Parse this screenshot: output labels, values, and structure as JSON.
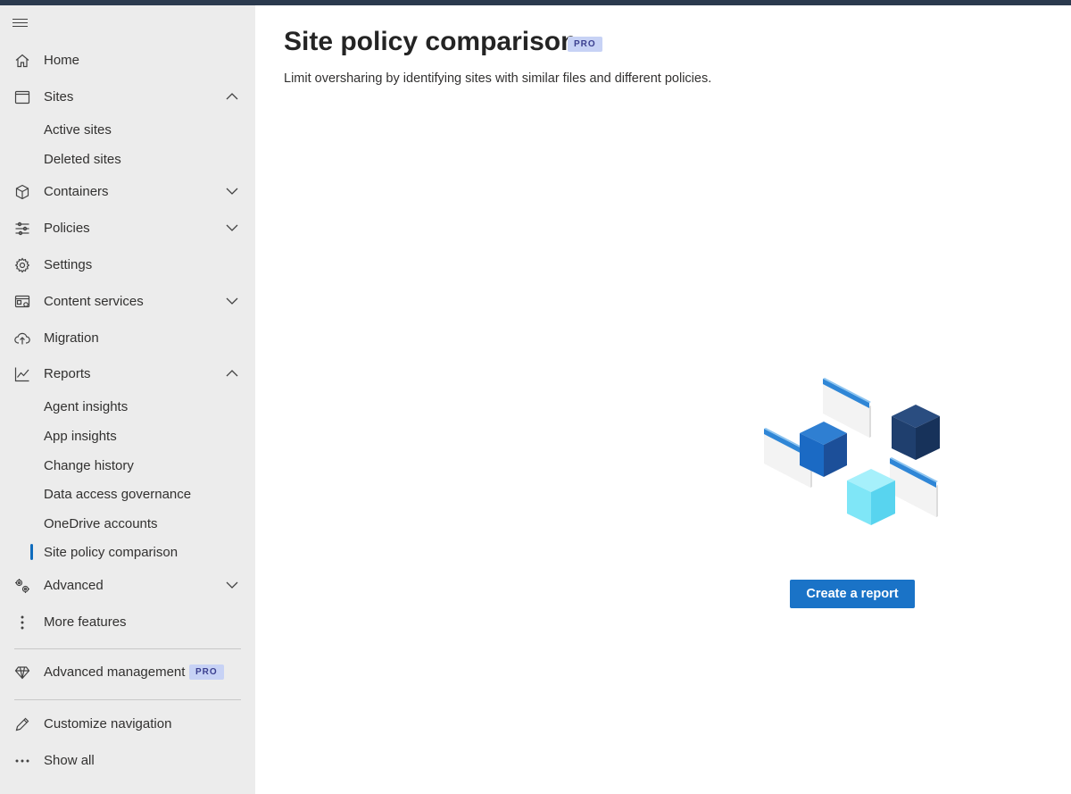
{
  "nav": {
    "items": [
      {
        "id": "home",
        "label": "Home",
        "icon": "home-icon"
      },
      {
        "id": "sites",
        "label": "Sites",
        "icon": "browser-window-icon",
        "expanded": true,
        "children": [
          {
            "label": "Active sites"
          },
          {
            "label": "Deleted sites"
          }
        ]
      },
      {
        "id": "containers",
        "label": "Containers",
        "icon": "cube-icon",
        "expanded": false
      },
      {
        "id": "policies",
        "label": "Policies",
        "icon": "sliders-icon",
        "expanded": false
      },
      {
        "id": "settings",
        "label": "Settings",
        "icon": "gear-icon"
      },
      {
        "id": "content-services",
        "label": "Content services",
        "icon": "content-services-icon",
        "expanded": false
      },
      {
        "id": "migration",
        "label": "Migration",
        "icon": "cloud-upload-icon"
      },
      {
        "id": "reports",
        "label": "Reports",
        "icon": "line-chart-icon",
        "expanded": true,
        "children": [
          {
            "label": "Agent insights"
          },
          {
            "label": "App insights"
          },
          {
            "label": "Change history"
          },
          {
            "label": "Data access governance"
          },
          {
            "label": "OneDrive accounts"
          },
          {
            "label": "Site policy comparison",
            "selected": true
          }
        ]
      },
      {
        "id": "advanced",
        "label": "Advanced",
        "icon": "gears-icon",
        "expanded": false
      },
      {
        "id": "more-features",
        "label": "More features",
        "icon": "vertical-ellipsis-icon"
      }
    ],
    "advanced_management": {
      "label": "Advanced management",
      "badge": "PRO",
      "icon": "diamond-icon"
    },
    "customize": {
      "label": "Customize navigation",
      "icon": "pencil-icon"
    },
    "show_all": {
      "label": "Show all",
      "icon": "horizontal-ellipsis-icon"
    }
  },
  "main": {
    "title": "Site policy comparison",
    "badge": "PRO",
    "subtitle": "Limit oversharing by identifying sites with similar files and different policies.",
    "create_button": "Create a report"
  },
  "colors": {
    "accent": "#1a73c7",
    "sidebar_bg": "#ececec",
    "topbar": "#2b3a4e",
    "badge_bg": "#c7d2f5",
    "selected_indicator": "#0f6cbd"
  }
}
